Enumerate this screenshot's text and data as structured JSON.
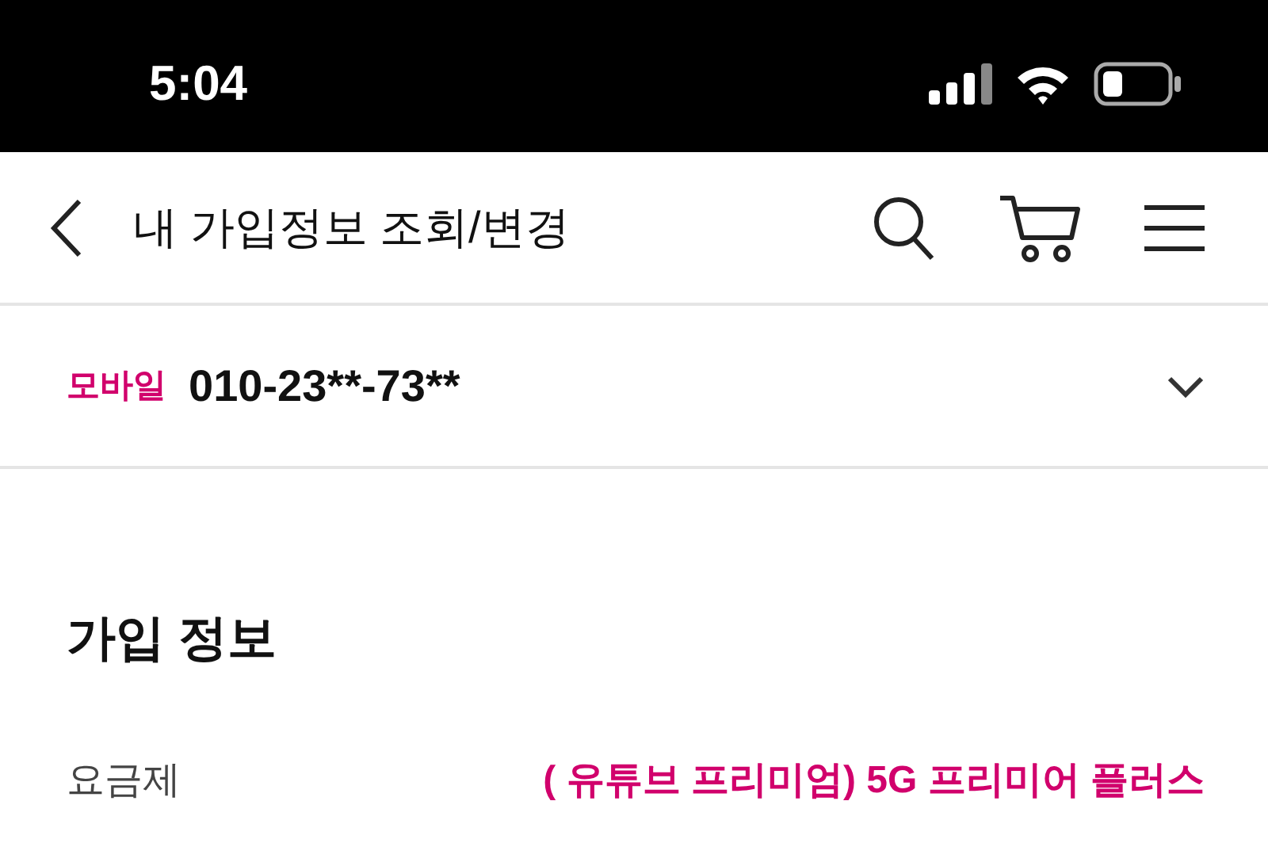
{
  "status_bar": {
    "time": "5:04"
  },
  "header": {
    "title": "내 가입정보 조회/변경"
  },
  "line_selector": {
    "type_label": "모바일",
    "number": "010-23**-73**"
  },
  "section": {
    "title": "가입 정보",
    "rows": [
      {
        "label": "요금제",
        "value": "( 유튜브 프리미엄) 5G 프리미어 플러스"
      }
    ]
  }
}
